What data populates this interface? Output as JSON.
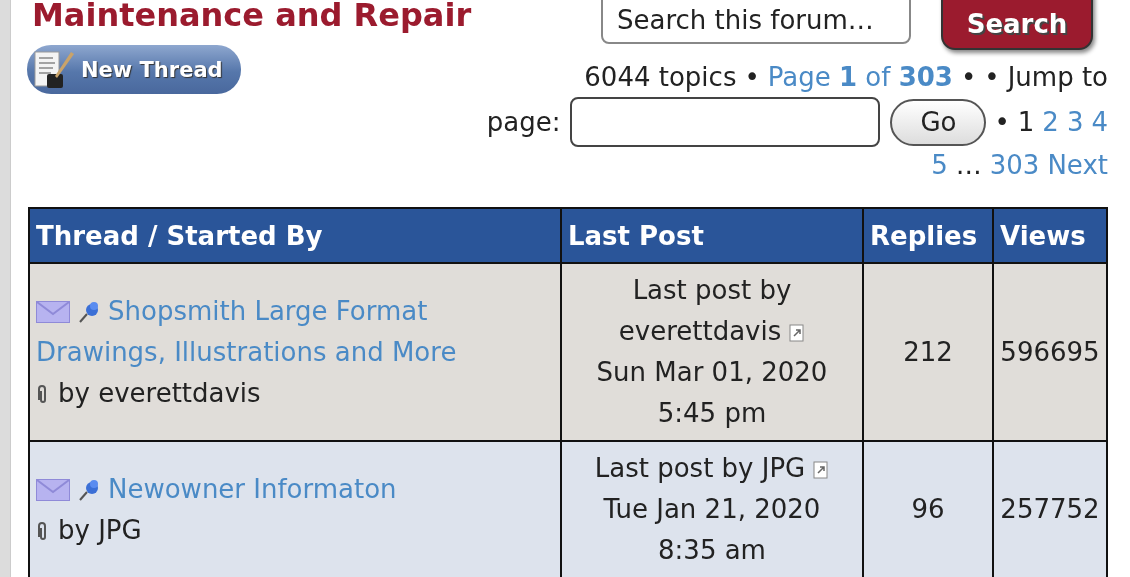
{
  "forum": {
    "title": "Maintenance and Repair",
    "search": {
      "placeholder": "Search this forum…",
      "button": "Search"
    },
    "new_thread": "New Thread"
  },
  "pagination": {
    "lines": [
      [
        {
          "kind": "text",
          "text": "6044 topics"
        },
        {
          "kind": "sep",
          "text": "•"
        },
        {
          "kind": "link",
          "text": "Page **1** of **303**"
        },
        {
          "kind": "sep",
          "text": "•"
        },
        {
          "kind": "sep",
          "text": "•"
        },
        {
          "kind": "text",
          "text": "Jump to"
        }
      ],
      [
        {
          "kind": "text",
          "text": "page:"
        },
        {
          "kind": "input"
        },
        {
          "kind": "button",
          "text": "Go"
        },
        {
          "kind": "sep",
          "text": "•"
        },
        {
          "kind": "page",
          "text": "1",
          "selected": true
        },
        {
          "kind": "page",
          "text": "2",
          "selected": false
        },
        {
          "kind": "page",
          "text": "3",
          "selected": false
        },
        {
          "kind": "page",
          "text": "4",
          "selected": false
        }
      ],
      [
        {
          "kind": "page",
          "text": "5",
          "selected": false
        },
        {
          "kind": "text",
          "text": "…"
        },
        {
          "kind": "page",
          "text": "303",
          "selected": false
        },
        {
          "kind": "link",
          "text": "Next"
        }
      ]
    ]
  },
  "table": {
    "columns": [
      "Thread / Started By",
      "Last Post",
      "Replies",
      "Views"
    ],
    "rows": [
      {
        "title": "Shopsmith Large Format Drawings, Illustrations and More",
        "starter": "by everettdavis",
        "last_post_label": "Last post by",
        "last_post_author": "everettdavis",
        "last_post_date": "Sun Mar 01, 2020",
        "last_post_time": "5:45 pm",
        "replies": "212",
        "views": "596695"
      },
      {
        "title": "Newowner Informaton",
        "starter": "by JPG",
        "last_post_label": "Last post by",
        "last_post_author": "JPG",
        "last_post_date": "Tue Jan 21, 2020",
        "last_post_time": "8:35 am",
        "replies": "96",
        "views": "257752"
      }
    ]
  }
}
